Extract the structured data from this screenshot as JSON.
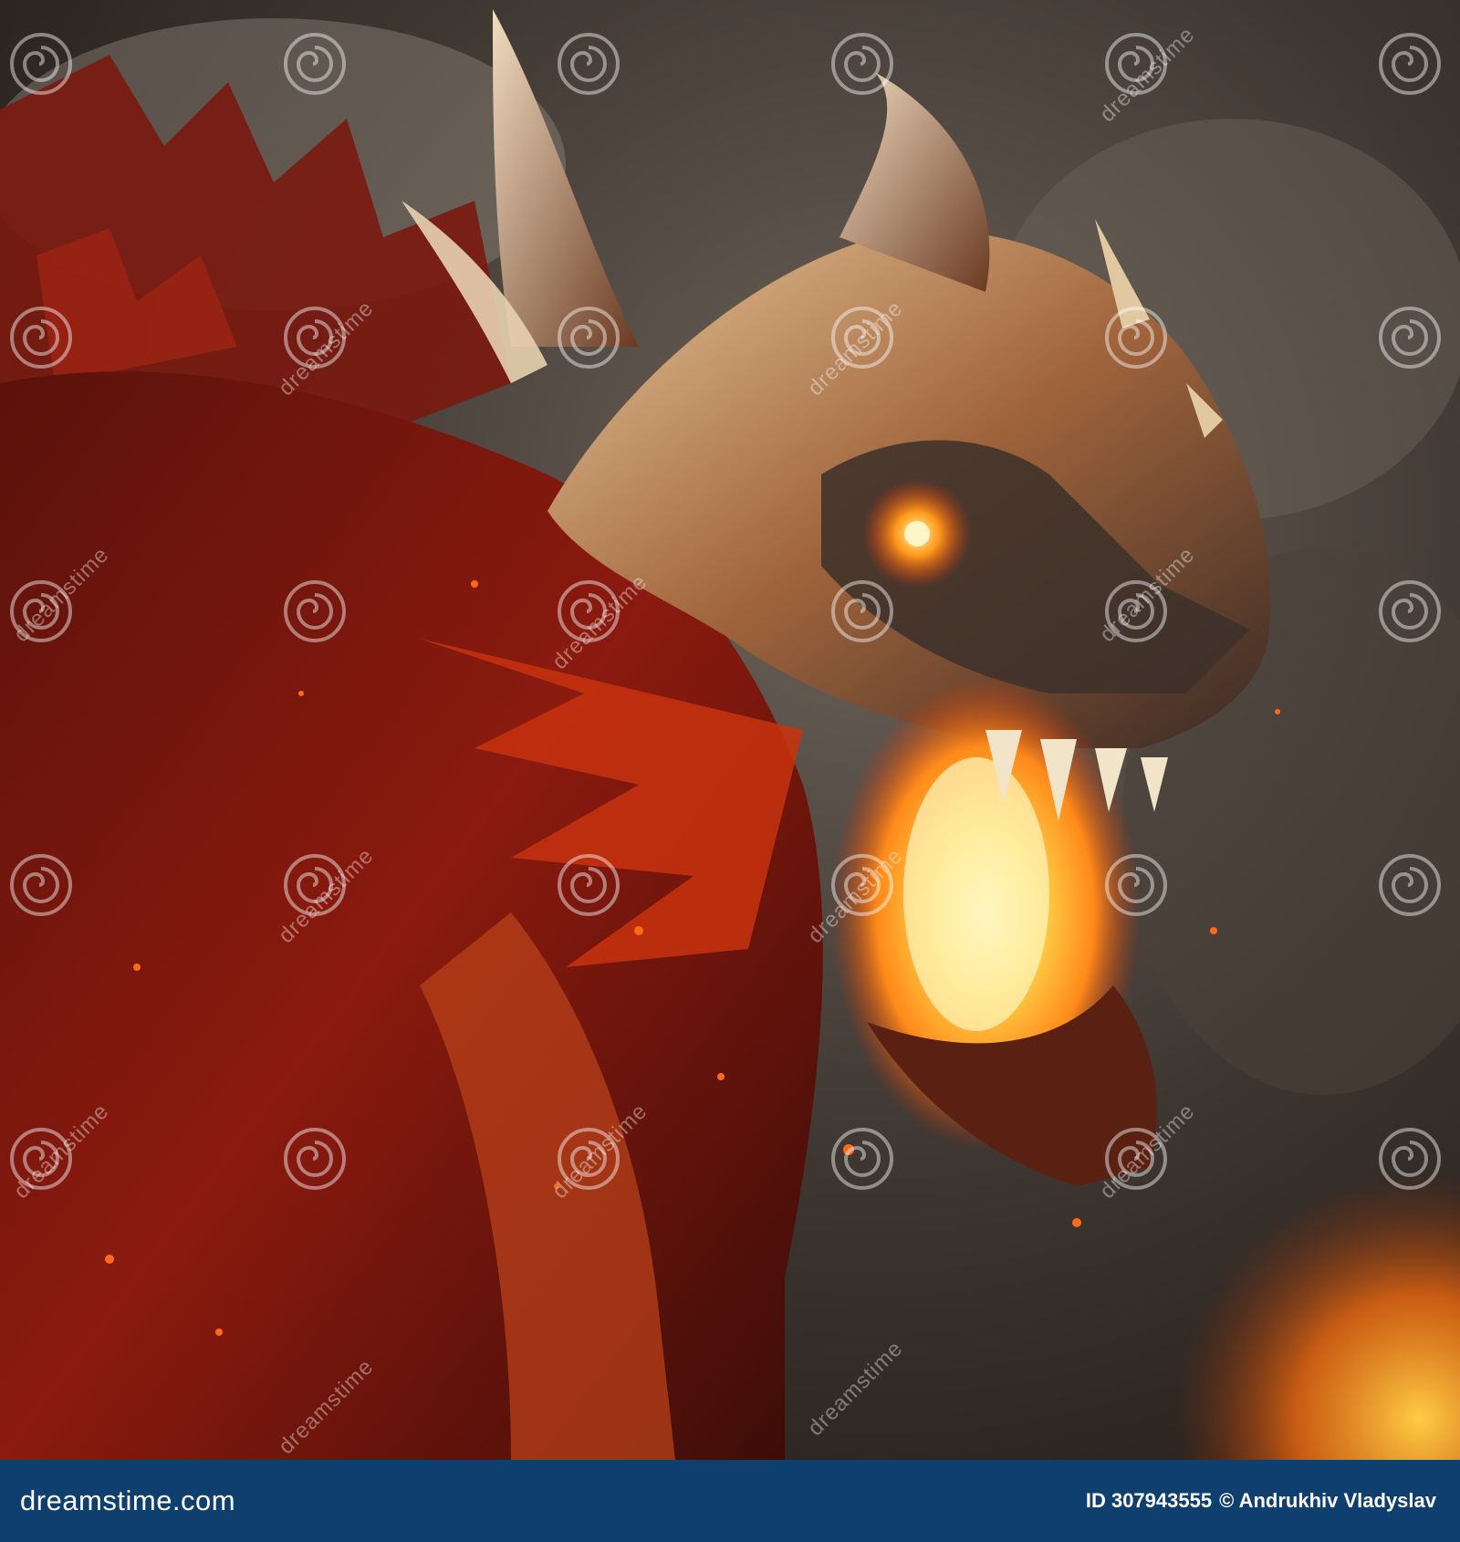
{
  "image": {
    "subject": "illustration",
    "palette": {
      "smoke": "#3e3630",
      "smoke_light": "#8d847a",
      "dragon_dark": "#3a0c08",
      "dragon_red": "#8b1a0f",
      "scale_gold": "#d8b48a",
      "fire_core": "#fff1a0",
      "fire_mid": "#ffb21e",
      "fire_outer": "#e8440c",
      "eye_glow": "#ff9a1a"
    }
  },
  "watermark": {
    "text": "dreamstime",
    "icon": "swirl-icon"
  },
  "footer": {
    "background": "#0f3f6f",
    "logo_text": "dreamstime.com",
    "id_text": "ID 307943555",
    "author_text": "© Andrukhiv Vladyslav"
  }
}
